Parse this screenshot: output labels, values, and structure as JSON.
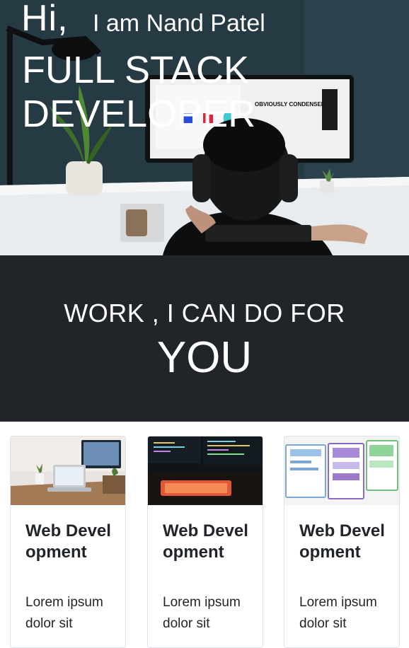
{
  "hero": {
    "greeting": "Hi,",
    "intro": "I am Nand Patel",
    "role": "FULL STACK DEVELOPER",
    "monitor_text": "OBVIOUSLY CONDENSED"
  },
  "services_band": {
    "line1": "WORK , I CAN DO FOR",
    "line2": "YOU"
  },
  "cards": [
    {
      "title": "Web Development",
      "text": "Lorem ipsum dolor sit",
      "image_icon": "desk-workspace-image"
    },
    {
      "title": "Web Development",
      "text": "Lorem ipsum dolor sit",
      "image_icon": "code-monitor-image"
    },
    {
      "title": "Web Development",
      "text": "Lorem ipsum dolor sit",
      "image_icon": "wireframe-sketch-image"
    }
  ],
  "colors": {
    "band_background": "#212529",
    "text_dark": "#212529",
    "border": "#dee2e6"
  }
}
